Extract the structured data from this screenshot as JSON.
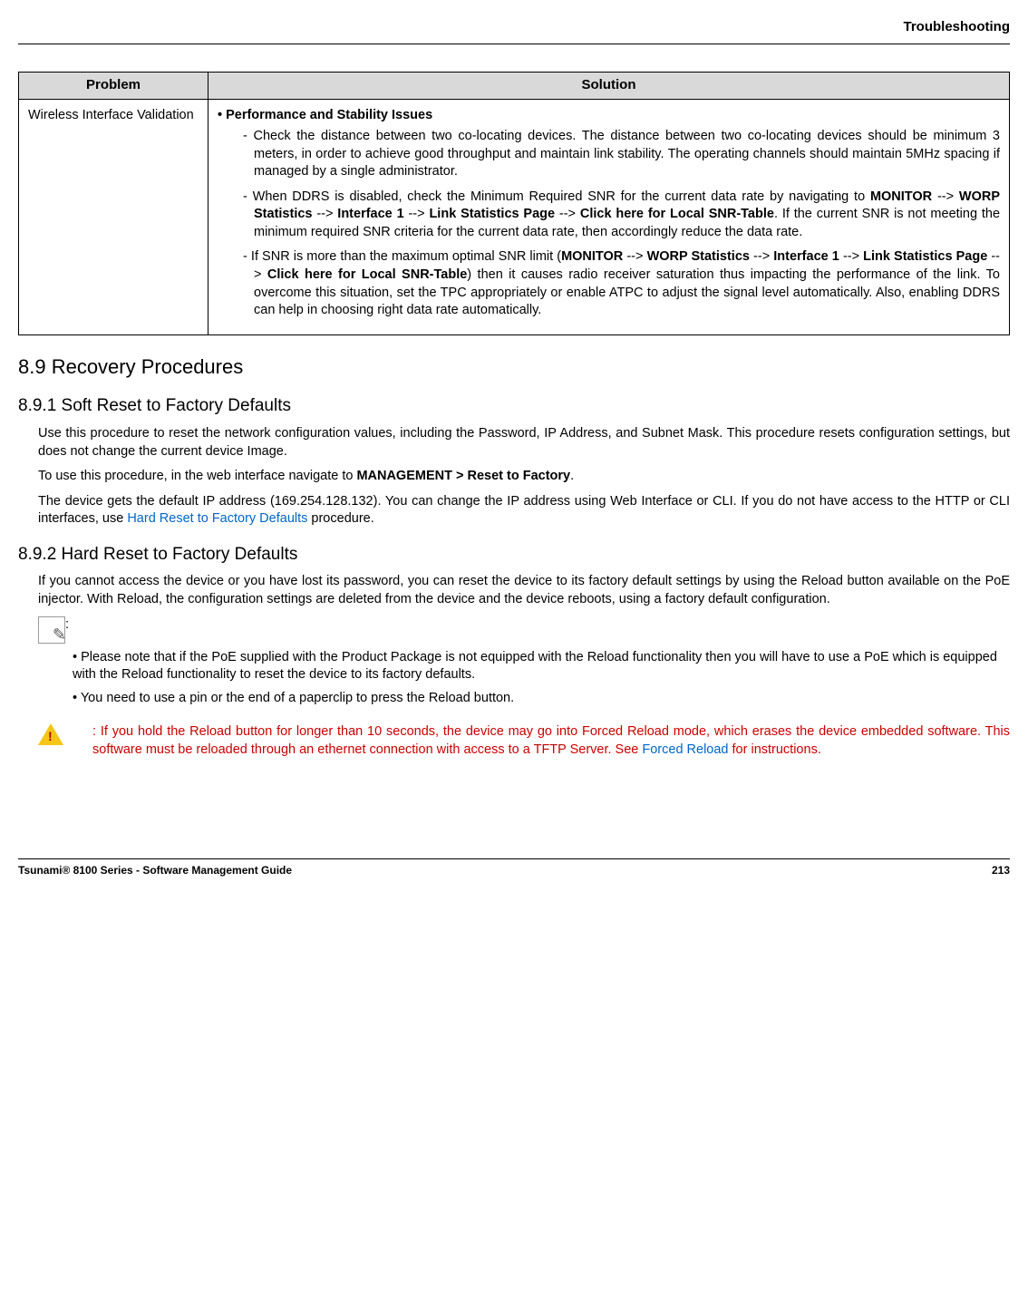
{
  "header": {
    "title": "Troubleshooting"
  },
  "table": {
    "headers": {
      "problem": "Problem",
      "solution": "Solution"
    },
    "row": {
      "problem": "Wireless Interface Validation",
      "bullet_label": "•  Performance and Stability Issues",
      "item1_a": "- Check the distance between two co-locating devices. The distance between two co-locating devices should be minimum 3 meters, in order to achieve good throughput and maintain link stability. The operating channels should maintain 5MHz spacing if managed by a single administrator.",
      "item2_a": "- When DDRS is disabled, check the Minimum Required SNR for the current data rate by navigating to ",
      "item2_b_monitor": "MONITOR",
      "item2_arrow1": " --> ",
      "item2_b_worp": "WORP Statistics",
      "item2_arrow2": " --> ",
      "item2_b_if1": "Interface 1",
      "item2_arrow3": " --> ",
      "item2_b_lsp": "Link Statistics Page",
      "item2_arrow4": " --> ",
      "item2_b_snr": "Click here for Local SNR-Table",
      "item2_c": ". If the current SNR is not meeting the minimum required SNR criteria for the current data rate, then accordingly reduce the data rate.",
      "item3_a": "- If SNR is more than the maximum optimal SNR limit (",
      "item3_b_monitor": "MONITOR",
      "item3_arrow1": " --> ",
      "item3_b_worp": "WORP Statistics",
      "item3_arrow2": " --> ",
      "item3_b_if1": "Interface 1",
      "item3_arrow3": " --> ",
      "item3_b_lsp": "Link Statistics Page",
      "item3_arrow4": " --> ",
      "item3_b_snr": "Click here for Local SNR-Table",
      "item3_c": ") then it causes radio receiver saturation thus impacting the performance of the link. To overcome this situation, set the TPC appropriately or enable ATPC to adjust the signal level automatically. Also, enabling DDRS can help in choosing right data rate automatically."
    }
  },
  "s89": {
    "title": "8.9 Recovery Procedures",
    "s891": {
      "title": "8.9.1 Soft Reset to Factory Defaults",
      "p1": "Use this procedure to reset the network configuration values, including the Password, IP Address, and Subnet Mask. This procedure resets configuration settings, but does not change the current device Image.",
      "p2_a": "To use this procedure, in the web interface navigate to ",
      "p2_b": "MANAGEMENT > Reset to Factory",
      "p2_c": ".",
      "p3_a": "The device gets the default IP address (169.254.128.132). You can change the IP address using Web Interface or CLI. If you do not have access to the HTTP or CLI interfaces, use ",
      "p3_link": "Hard Reset to Factory Defaults",
      "p3_b": " procedure."
    },
    "s892": {
      "title": "8.9.2 Hard Reset to Factory Defaults",
      "p1": "If you cannot access the device or you have lost its password, you can reset the device to its factory default settings by using the Reload button available on the PoE injector. With Reload, the configuration settings are deleted from the device and the device reboots, using a factory default configuration.",
      "note_colon": ":",
      "note1": "• Please note that if the PoE supplied with the Product Package is not equipped with the Reload functionality then you will have to use a PoE which is equipped with the Reload functionality to reset the device to its factory defaults.",
      "note2": "• You need to use a pin or the end of a paperclip to press the Reload button.",
      "warn_a": ": If you hold the Reload button for longer than 10 seconds, the device may go into Forced Reload mode, which erases the device embedded software. This software must be reloaded through an ethernet connection with access to a TFTP Server. See ",
      "warn_link": "Forced Reload",
      "warn_b": " for instructions."
    }
  },
  "footer": {
    "left": "Tsunami® 8100 Series - Software Management Guide",
    "right": "213"
  }
}
